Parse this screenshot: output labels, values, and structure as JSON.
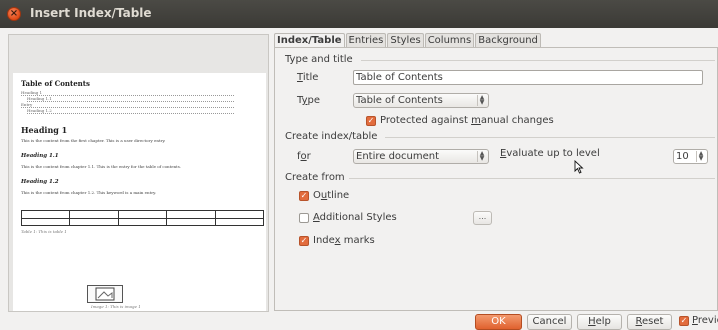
{
  "window": {
    "title": "Insert Index/Table",
    "close_glyph": "×"
  },
  "preview": {
    "toc_title": "Table of Contents",
    "toc_entries": [
      "Heading 1",
      "Heading 1.1",
      "Entry",
      "Heading 1.2"
    ],
    "heading1": "Heading 1",
    "heading1_text": "This is the content from the first chapter. This is a user directory entry.",
    "heading11": "Heading 1.1",
    "heading11_text": "This is the content from chapter 1.1. This is the entry for the table of contents.",
    "heading12": "Heading 1.2",
    "heading12_text": "This is the content from chapter 1.2. This keyword is a main entry.",
    "table_caption": "Table 1: This is table 1",
    "image_caption": "Image 1: This is image 1"
  },
  "tabs": [
    {
      "label": "Index/Table",
      "active": true
    },
    {
      "label": "Entries"
    },
    {
      "label": "Styles"
    },
    {
      "label": "Columns"
    },
    {
      "label": "Background"
    }
  ],
  "type_and_title": {
    "heading": "Type and title",
    "title_label": "Title",
    "title_value": "Table of Contents",
    "type_label": "Type",
    "type_value": "Table of Contents",
    "protected_label": "Protected against manual changes",
    "protected_checked": true
  },
  "create_index": {
    "heading": "Create index/table",
    "for_label": "for",
    "for_value": "Entire document",
    "evaluate_label": "Evaluate up to level",
    "level_value": "10"
  },
  "create_from": {
    "heading": "Create from",
    "outline_label": "Outline",
    "outline_checked": true,
    "additional_styles_label": "Additional Styles",
    "additional_styles_checked": false,
    "styles_button": "...",
    "index_marks_label": "Index marks",
    "index_marks_checked": true
  },
  "buttons": {
    "ok": "OK",
    "cancel": "Cancel",
    "help": "Help",
    "reset": "Reset",
    "preview_label": "Preview",
    "preview_checked": true
  },
  "colors": {
    "accent": "#e26c3d",
    "titlebar": "#3f3e3a"
  }
}
